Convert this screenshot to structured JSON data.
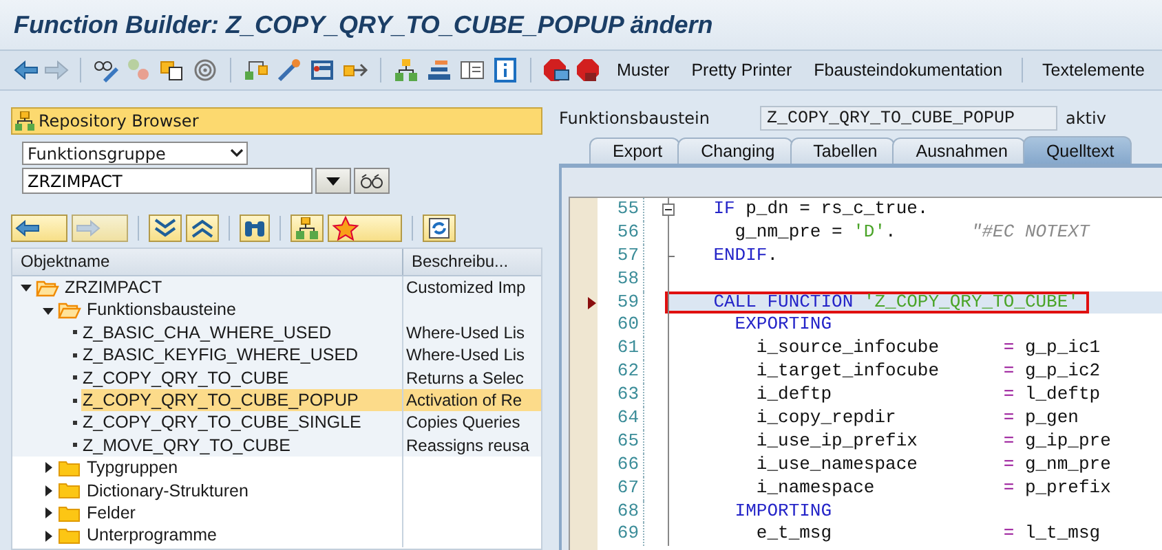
{
  "window": {
    "title": "Function Builder: Z_COPY_QRY_TO_CUBE_POPUP ändern"
  },
  "toolbar": {
    "nav": [
      {
        "disabled": false
      },
      {
        "disabled": true
      }
    ],
    "text_buttons": [
      "Muster",
      "Pretty Printer",
      "Fbausteindokumentation",
      "Textelemente"
    ]
  },
  "repository_browser": {
    "title": "Repository Browser",
    "object_type": "Funktionsgruppe",
    "object_name": "ZRZIMPACT",
    "columns": [
      "Objektname",
      "Beschreibu..."
    ],
    "tree": [
      {
        "kind": "folder",
        "name": "ZRZIMPACT",
        "description": "Customized Imp",
        "expanded": true,
        "children": [
          {
            "kind": "folder",
            "name": "Funktionsbausteine",
            "expanded": true,
            "children": [
              {
                "kind": "leaf",
                "name": "Z_BASIC_CHA_WHERE_USED",
                "description": "Where-Used Lis",
                "selected": false
              },
              {
                "kind": "leaf",
                "name": "Z_BASIC_KEYFIG_WHERE_USED",
                "description": "Where-Used Lis",
                "selected": false
              },
              {
                "kind": "leaf",
                "name": "Z_COPY_QRY_TO_CUBE",
                "description": "Returns a Selec",
                "selected": false
              },
              {
                "kind": "leaf",
                "name": "Z_COPY_QRY_TO_CUBE_POPUP",
                "description": "Activation of Re",
                "selected": true
              },
              {
                "kind": "leaf",
                "name": "Z_COPY_QRY_TO_CUBE_SINGLE",
                "description": "Copies Queries",
                "selected": false
              },
              {
                "kind": "leaf",
                "name": "Z_MOVE_QRY_TO_CUBE",
                "description": "Reassigns reusa",
                "selected": false
              }
            ]
          },
          {
            "kind": "folder",
            "name": "Typgruppen",
            "expanded": false
          },
          {
            "kind": "folder",
            "name": "Dictionary-Strukturen",
            "expanded": false
          },
          {
            "kind": "folder",
            "name": "Felder",
            "expanded": false
          },
          {
            "kind": "folder",
            "name": "Unterprogramme",
            "expanded": false
          }
        ]
      }
    ]
  },
  "header": {
    "label": "Funktionsbaustein",
    "value": "Z_COPY_QRY_TO_CUBE_POPUP",
    "status": "aktiv"
  },
  "tabs": [
    {
      "label": "Export",
      "selected": false
    },
    {
      "label": "Changing",
      "selected": false
    },
    {
      "label": "Tabellen",
      "selected": false
    },
    {
      "label": "Ausnahmen",
      "selected": false
    },
    {
      "label": "Quelltext",
      "selected": true
    }
  ],
  "code": [
    {
      "number": "55",
      "fold_start": true,
      "fold_end": false,
      "selected": false,
      "tokens": [
        {
          "kind": "keyword",
          "text": "    IF"
        },
        {
          "kind": "plain",
          "text": " p_dn = rs_c_true."
        }
      ]
    },
    {
      "number": "56",
      "fold_start": false,
      "fold_end": false,
      "selected": false,
      "tokens": [
        {
          "kind": "plain",
          "text": "      g_nm_pre = "
        },
        {
          "kind": "string",
          "text": "'D'"
        },
        {
          "kind": "plain",
          "text": "."
        },
        {
          "kind": "comment",
          "text": "       \"#EC NOTEXT"
        }
      ]
    },
    {
      "number": "57",
      "fold_start": false,
      "fold_end": true,
      "selected": false,
      "tokens": [
        {
          "kind": "keyword",
          "text": "    ENDIF"
        },
        {
          "kind": "plain",
          "text": "."
        }
      ]
    },
    {
      "number": "58",
      "fold_start": false,
      "fold_end": false,
      "selected": false
    },
    {
      "number": "59",
      "fold_start": false,
      "fold_end": false,
      "selected": true,
      "tokens": [
        {
          "kind": "keyword",
          "text": "    CALL FUNCTION"
        },
        {
          "kind": "string",
          "text": " 'Z_COPY_QRY_TO_CUBE'"
        }
      ]
    },
    {
      "number": "60",
      "fold_start": false,
      "fold_end": false,
      "selected": false,
      "tokens": [
        {
          "kind": "keyword",
          "text": "      EXPORTING"
        }
      ]
    },
    {
      "number": "61",
      "fold_start": false,
      "fold_end": false,
      "selected": false,
      "tokens": [
        {
          "kind": "plain",
          "text": "        i_source_infocube      "
        },
        {
          "kind": "operator",
          "text": "="
        },
        {
          "kind": "plain",
          "text": " g_p_ic1"
        }
      ]
    },
    {
      "number": "62",
      "fold_start": false,
      "fold_end": false,
      "selected": false,
      "tokens": [
        {
          "kind": "plain",
          "text": "        i_target_infocube      "
        },
        {
          "kind": "operator",
          "text": "="
        },
        {
          "kind": "plain",
          "text": " g_p_ic2"
        }
      ]
    },
    {
      "number": "63",
      "fold_start": false,
      "fold_end": false,
      "selected": false,
      "tokens": [
        {
          "kind": "plain",
          "text": "        i_deftp                "
        },
        {
          "kind": "operator",
          "text": "="
        },
        {
          "kind": "plain",
          "text": " l_deftp"
        }
      ]
    },
    {
      "number": "64",
      "fold_start": false,
      "fold_end": false,
      "selected": false,
      "tokens": [
        {
          "kind": "plain",
          "text": "        i_copy_repdir          "
        },
        {
          "kind": "operator",
          "text": "="
        },
        {
          "kind": "plain",
          "text": " p_gen"
        }
      ]
    },
    {
      "number": "65",
      "fold_start": false,
      "fold_end": false,
      "selected": false,
      "tokens": [
        {
          "kind": "plain",
          "text": "        i_use_ip_prefix        "
        },
        {
          "kind": "operator",
          "text": "="
        },
        {
          "kind": "plain",
          "text": " g_ip_pre"
        }
      ]
    },
    {
      "number": "66",
      "fold_start": false,
      "fold_end": false,
      "selected": false,
      "tokens": [
        {
          "kind": "plain",
          "text": "        i_use_namespace        "
        },
        {
          "kind": "operator",
          "text": "="
        },
        {
          "kind": "plain",
          "text": " g_nm_pre"
        }
      ]
    },
    {
      "number": "67",
      "fold_start": false,
      "fold_end": false,
      "selected": false,
      "tokens": [
        {
          "kind": "plain",
          "text": "        i_namespace            "
        },
        {
          "kind": "operator",
          "text": "="
        },
        {
          "kind": "plain",
          "text": " p_prefix"
        }
      ]
    },
    {
      "number": "68",
      "fold_start": false,
      "fold_end": false,
      "selected": false,
      "tokens": [
        {
          "kind": "keyword",
          "text": "      IMPORTING"
        }
      ]
    },
    {
      "number": "69",
      "fold_start": false,
      "fold_end": false,
      "selected": false,
      "tokens": [
        {
          "kind": "plain",
          "text": "        e_t_msg                "
        },
        {
          "kind": "operator",
          "text": "="
        },
        {
          "kind": "plain",
          "text": " l_t_msg"
        }
      ]
    }
  ]
}
